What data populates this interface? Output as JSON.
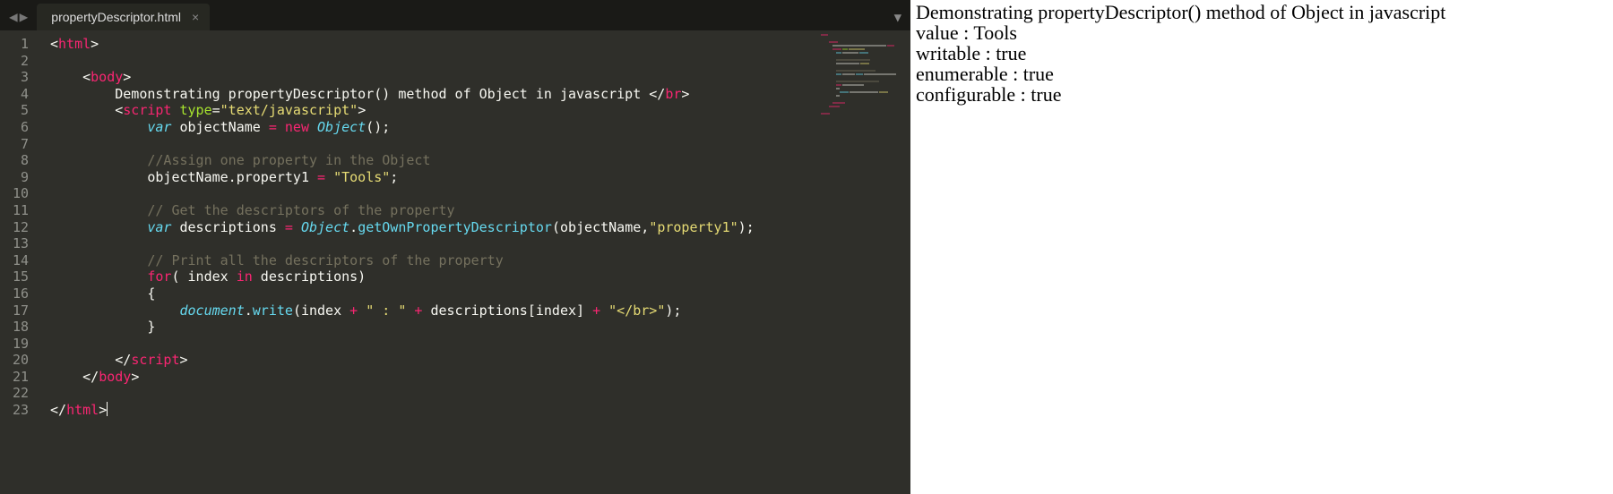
{
  "tabbar": {
    "filename": "propertyDescriptor.html",
    "nav_prev": "◀",
    "nav_next": "▶",
    "close": "×",
    "dropdown": "▼"
  },
  "gutter": {
    "start": 1,
    "end": 23
  },
  "code": {
    "lines": [
      [
        [
          "c-punct",
          "<"
        ],
        [
          "c-tag",
          "html"
        ],
        [
          "c-punct",
          ">"
        ]
      ],
      [],
      [
        [
          "c-plain",
          "    "
        ],
        [
          "c-punct",
          "<"
        ],
        [
          "c-tag",
          "body"
        ],
        [
          "c-punct",
          ">"
        ]
      ],
      [
        [
          "c-plain",
          "        Demonstrating propertyDescriptor() method of Object in javascript "
        ],
        [
          "c-punct",
          "</"
        ],
        [
          "c-tag",
          "br"
        ],
        [
          "c-punct",
          ">"
        ]
      ],
      [
        [
          "c-plain",
          "        "
        ],
        [
          "c-punct",
          "<"
        ],
        [
          "c-tag",
          "script"
        ],
        [
          "c-plain",
          " "
        ],
        [
          "c-attr",
          "type"
        ],
        [
          "c-punct",
          "="
        ],
        [
          "c-str",
          "\"text/javascript\""
        ],
        [
          "c-punct",
          ">"
        ]
      ],
      [
        [
          "c-plain",
          "            "
        ],
        [
          "c-stor",
          "var"
        ],
        [
          "c-plain",
          " objectName "
        ],
        [
          "c-op",
          "="
        ],
        [
          "c-plain",
          " "
        ],
        [
          "c-op",
          "new"
        ],
        [
          "c-plain",
          " "
        ],
        [
          "c-type",
          "Object"
        ],
        [
          "c-plain",
          "();"
        ]
      ],
      [],
      [
        [
          "c-plain",
          "            "
        ],
        [
          "c-cmt",
          "//Assign one property in the Object"
        ]
      ],
      [
        [
          "c-plain",
          "            objectName.property1 "
        ],
        [
          "c-op",
          "="
        ],
        [
          "c-plain",
          " "
        ],
        [
          "c-str",
          "\"Tools\""
        ],
        [
          "c-plain",
          ";"
        ]
      ],
      [],
      [
        [
          "c-plain",
          "            "
        ],
        [
          "c-cmt",
          "// Get the descriptors of the property"
        ]
      ],
      [
        [
          "c-plain",
          "            "
        ],
        [
          "c-stor",
          "var"
        ],
        [
          "c-plain",
          " descriptions "
        ],
        [
          "c-op",
          "="
        ],
        [
          "c-plain",
          " "
        ],
        [
          "c-type",
          "Object"
        ],
        [
          "c-plain",
          "."
        ],
        [
          "c-func",
          "getOwnPropertyDescriptor"
        ],
        [
          "c-plain",
          "(objectName,"
        ],
        [
          "c-str",
          "\"property1\""
        ],
        [
          "c-plain",
          ");"
        ]
      ],
      [],
      [
        [
          "c-plain",
          "            "
        ],
        [
          "c-cmt",
          "// Print all the descriptors of the property"
        ]
      ],
      [
        [
          "c-plain",
          "            "
        ],
        [
          "c-kw",
          "for"
        ],
        [
          "c-plain",
          "( index "
        ],
        [
          "c-kw",
          "in"
        ],
        [
          "c-plain",
          " descriptions)"
        ]
      ],
      [
        [
          "c-plain",
          "            {"
        ]
      ],
      [
        [
          "c-plain",
          "                "
        ],
        [
          "c-type",
          "document"
        ],
        [
          "c-plain",
          "."
        ],
        [
          "c-func",
          "write"
        ],
        [
          "c-plain",
          "(index "
        ],
        [
          "c-op",
          "+"
        ],
        [
          "c-plain",
          " "
        ],
        [
          "c-str",
          "\" : \""
        ],
        [
          "c-plain",
          " "
        ],
        [
          "c-op",
          "+"
        ],
        [
          "c-plain",
          " descriptions[index] "
        ],
        [
          "c-op",
          "+"
        ],
        [
          "c-plain",
          " "
        ],
        [
          "c-str",
          "\"</br>\""
        ],
        [
          "c-plain",
          ");"
        ]
      ],
      [
        [
          "c-plain",
          "            }"
        ]
      ],
      [],
      [
        [
          "c-plain",
          "        "
        ],
        [
          "c-punct",
          "</"
        ],
        [
          "c-tag",
          "script"
        ],
        [
          "c-punct",
          ">"
        ]
      ],
      [
        [
          "c-plain",
          "    "
        ],
        [
          "c-punct",
          "</"
        ],
        [
          "c-tag",
          "body"
        ],
        [
          "c-punct",
          ">"
        ]
      ],
      [],
      [
        [
          "c-punct",
          "</"
        ],
        [
          "c-tag",
          "html"
        ],
        [
          "c-punct",
          ">"
        ]
      ]
    ]
  },
  "output": {
    "line1": "Demonstrating propertyDescriptor() method of Object in javascript",
    "line2": "value : Tools",
    "line3": "writable : true",
    "line4": "enumerable : true",
    "line5": "configurable : true"
  },
  "minimap": {
    "rows": [
      [
        [
          "#f92672",
          8
        ]
      ],
      [],
      [
        [
          "#2f2f2a",
          8
        ],
        [
          "#f92672",
          10
        ]
      ],
      [
        [
          "#2f2f2a",
          12
        ],
        [
          "#e0e0d8",
          60
        ],
        [
          "#f92672",
          8
        ]
      ],
      [
        [
          "#2f2f2a",
          12
        ],
        [
          "#f92672",
          10
        ],
        [
          "#a6e22e",
          6
        ],
        [
          "#e6db74",
          18
        ]
      ],
      [
        [
          "#2f2f2a",
          16
        ],
        [
          "#66d9ef",
          6
        ],
        [
          "#e0e0d8",
          18
        ],
        [
          "#66d9ef",
          10
        ]
      ],
      [],
      [
        [
          "#2f2f2a",
          16
        ],
        [
          "#75715e",
          38
        ]
      ],
      [
        [
          "#2f2f2a",
          16
        ],
        [
          "#e0e0d8",
          26
        ],
        [
          "#e6db74",
          10
        ]
      ],
      [],
      [
        [
          "#2f2f2a",
          16
        ],
        [
          "#75715e",
          44
        ]
      ],
      [
        [
          "#2f2f2a",
          16
        ],
        [
          "#66d9ef",
          6
        ],
        [
          "#e0e0d8",
          14
        ],
        [
          "#66d9ef",
          8
        ],
        [
          "#e0e0d8",
          36
        ]
      ],
      [],
      [
        [
          "#2f2f2a",
          16
        ],
        [
          "#75715e",
          48
        ]
      ],
      [
        [
          "#2f2f2a",
          16
        ],
        [
          "#f92672",
          6
        ],
        [
          "#e0e0d8",
          24
        ]
      ],
      [
        [
          "#2f2f2a",
          16
        ],
        [
          "#e0e0d8",
          4
        ]
      ],
      [
        [
          "#2f2f2a",
          20
        ],
        [
          "#66d9ef",
          10
        ],
        [
          "#e0e0d8",
          32
        ],
        [
          "#e6db74",
          10
        ]
      ],
      [
        [
          "#2f2f2a",
          16
        ],
        [
          "#e0e0d8",
          4
        ]
      ],
      [],
      [
        [
          "#2f2f2a",
          12
        ],
        [
          "#f92672",
          14
        ]
      ],
      [
        [
          "#2f2f2a",
          8
        ],
        [
          "#f92672",
          12
        ]
      ],
      [],
      [
        [
          "#f92672",
          10
        ]
      ]
    ]
  }
}
